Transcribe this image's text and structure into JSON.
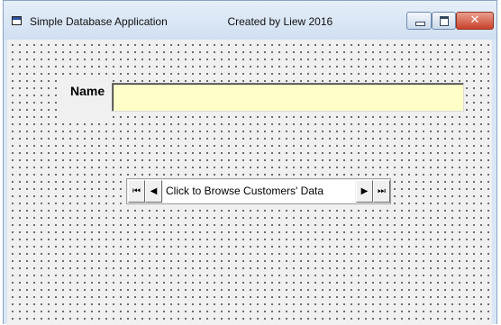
{
  "window": {
    "app_title": "Simple Database Application",
    "creator_text": "Created by Liew 2016",
    "icon": "form-window-icon",
    "buttons": {
      "minimize": "minimize-icon",
      "maximize": "maximize-icon",
      "close": "close-icon",
      "close_glyph": "✕"
    }
  },
  "form": {
    "name_label": "Name",
    "name_value": "",
    "input_color": "#ffffc8"
  },
  "data_control": {
    "caption": "Click to Browse Customers' Data",
    "first_glyph": "⏮",
    "prev_glyph": "◀",
    "next_glyph": "▶",
    "last_glyph": "⏭"
  }
}
